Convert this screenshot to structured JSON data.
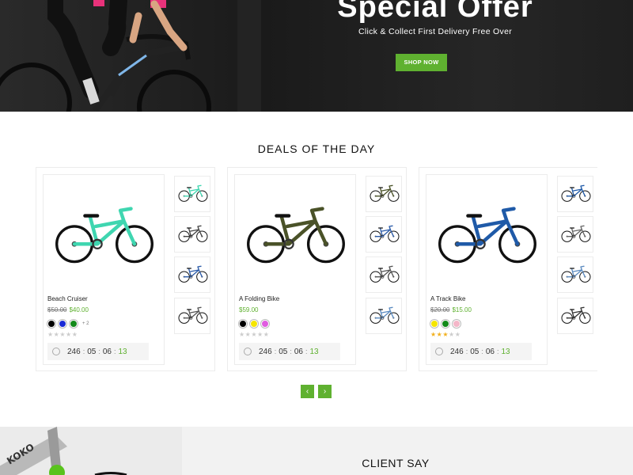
{
  "hero": {
    "title": "Special Offer",
    "subtitle": "Click & Collect First Delivery Free Over",
    "button": "SHOP NOW"
  },
  "deals": {
    "title": "DEALS OF THE DAY",
    "products": [
      {
        "name": "Beach Cruiser",
        "old_price": "$50.00",
        "price": "$40.00",
        "swatches": [
          "#000000",
          "#1a2ad6",
          "#138a1a"
        ],
        "more_colors": "+ 2",
        "rating": 0,
        "frame_color": "#3fd6b0",
        "timer": {
          "days": "246",
          "hours": "05",
          "minutes": "06",
          "seconds": "13"
        },
        "thumb_colors": [
          "#3fd6b0",
          "#444444",
          "#2a5aa8",
          "#555555"
        ]
      },
      {
        "name": "A Folding Bike",
        "old_price": "",
        "price": "$59.00",
        "swatches": [
          "#000000",
          "#f5e600",
          "#e05ce0"
        ],
        "more_colors": "",
        "rating": 0,
        "frame_color": "#4a5228",
        "timer": {
          "days": "246",
          "hours": "05",
          "minutes": "06",
          "seconds": "13"
        },
        "thumb_colors": [
          "#4a5228",
          "#2a5aa8",
          "#555555",
          "#5a8ac0"
        ]
      },
      {
        "name": "A Track Bike",
        "old_price": "$20.00",
        "price": "$15.00",
        "swatches": [
          "#f5e600",
          "#138a1a",
          "#f4b6c8"
        ],
        "more_colors": "",
        "rating": 3,
        "frame_color": "#1f5aa8",
        "timer": {
          "days": "246",
          "hours": "05",
          "minutes": "06",
          "seconds": "13"
        },
        "thumb_colors": [
          "#1f5aa8",
          "#666666",
          "#5a8ac0",
          "#333333"
        ]
      }
    ],
    "prev_icon": "‹",
    "next_icon": "›"
  },
  "client": {
    "title": "CLIENT SAY",
    "bike_text": "KOKO"
  },
  "colors": {
    "accent": "#5fb130"
  }
}
